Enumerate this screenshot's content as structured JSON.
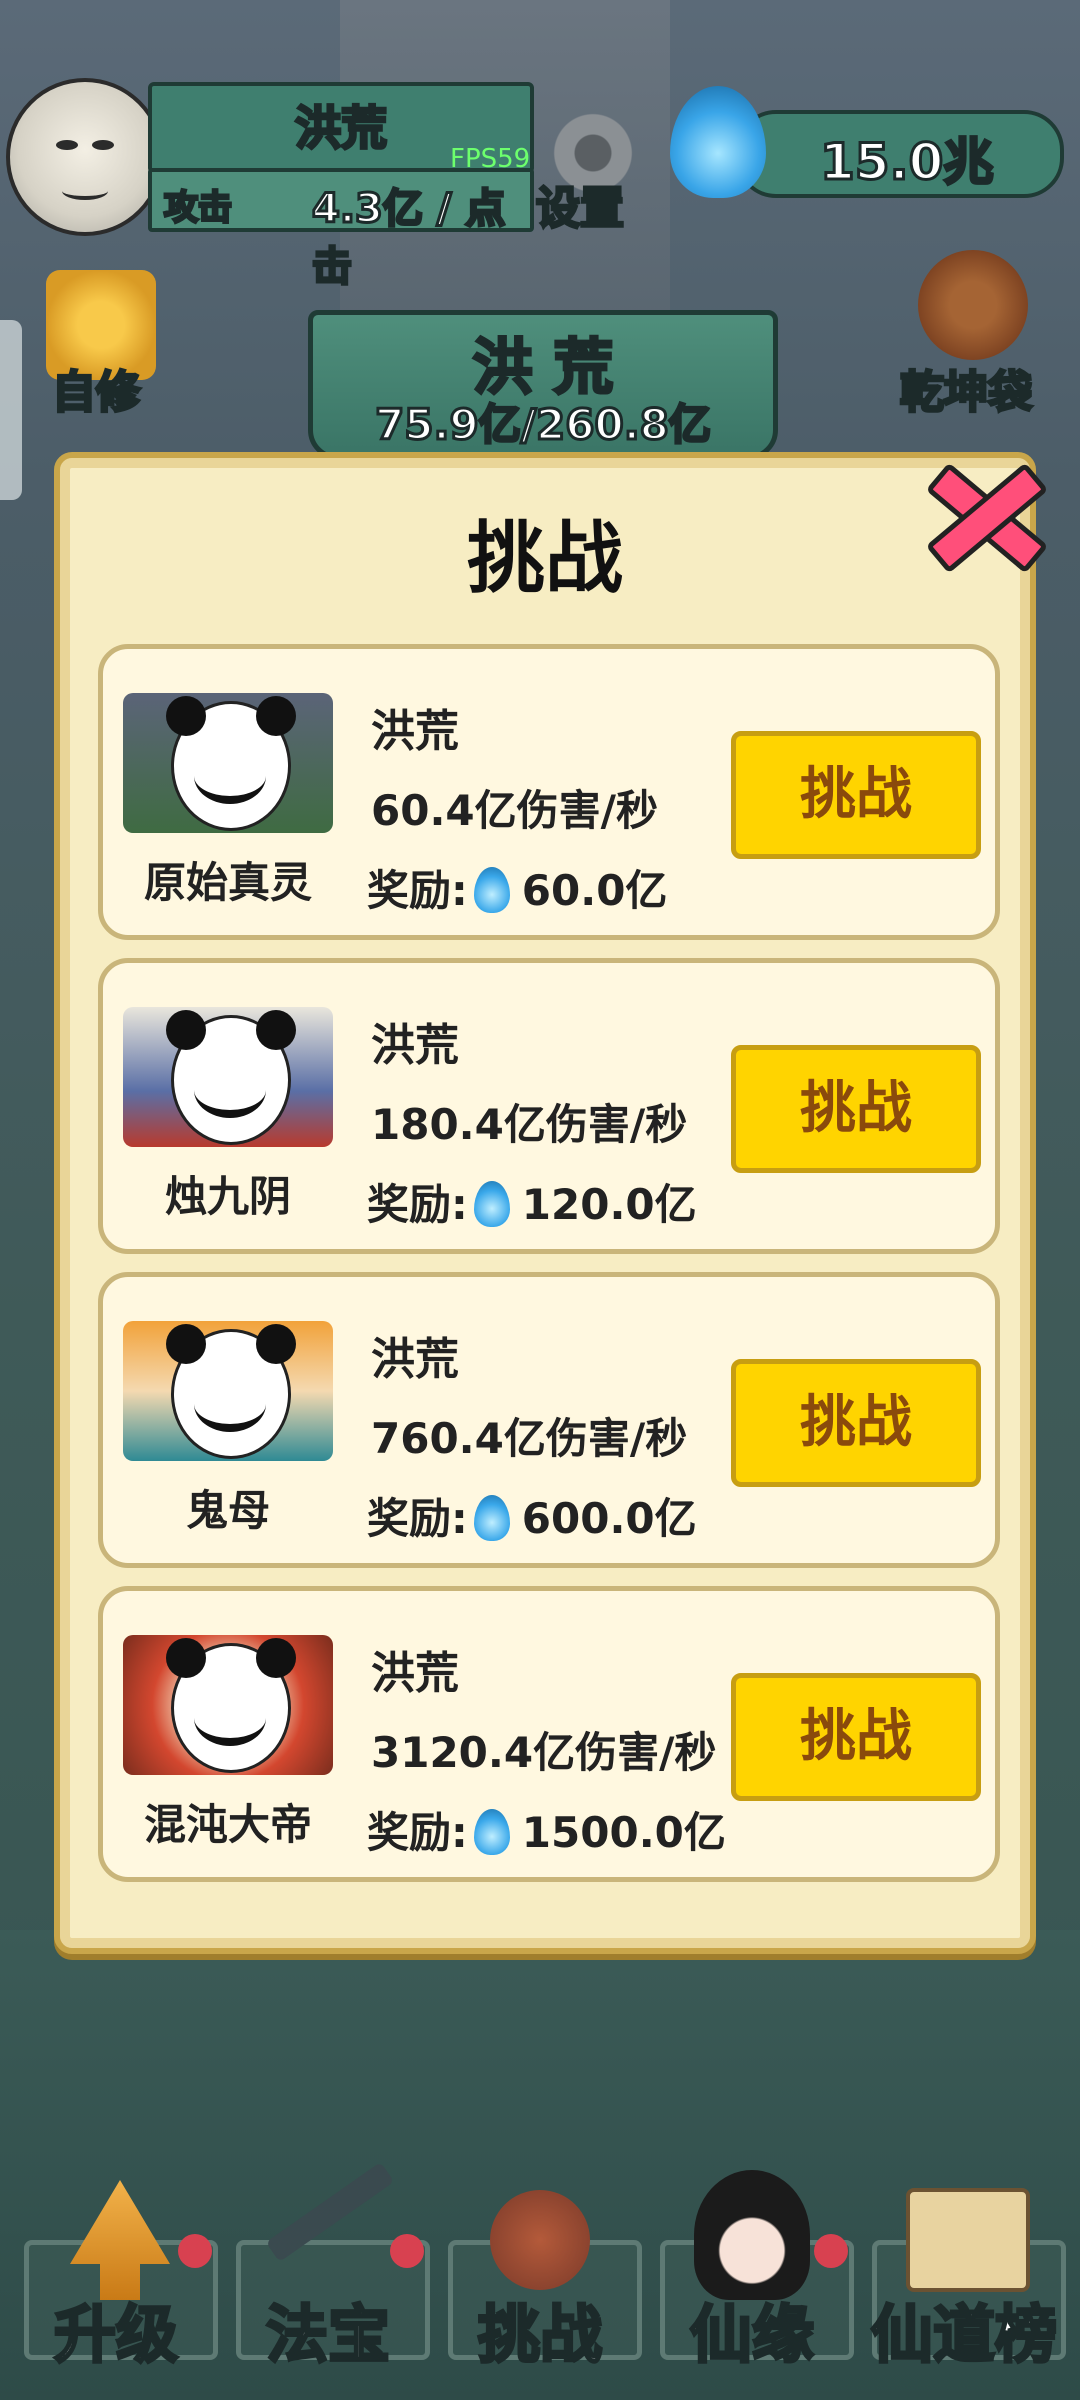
{
  "hud": {
    "player_name": "洪荒",
    "attack_label": "攻击",
    "attack_value": "4.3亿 / 点击",
    "fps": "FPS59",
    "settings_label": "设置",
    "currency": "15.0兆"
  },
  "side": {
    "left_label": "自修",
    "right_label": "乾坤袋"
  },
  "stage": {
    "title": "洪 荒",
    "progress": "75.9亿/260.8亿"
  },
  "modal": {
    "title": "挑战",
    "challenges": [
      {
        "boss": "原始真灵",
        "realm": "洪荒",
        "dps": "60.4亿伤害/秒",
        "reward_label": "奖励:",
        "reward": "60.0亿",
        "button": "挑战"
      },
      {
        "boss": "烛九阴",
        "realm": "洪荒",
        "dps": "180.4亿伤害/秒",
        "reward_label": "奖励:",
        "reward": "120.0亿",
        "button": "挑战"
      },
      {
        "boss": "鬼母",
        "realm": "洪荒",
        "dps": "760.4亿伤害/秒",
        "reward_label": "奖励:",
        "reward": "600.0亿",
        "button": "挑战"
      },
      {
        "boss": "混沌大帝",
        "realm": "洪荒",
        "dps": "3120.4亿伤害/秒",
        "reward_label": "奖励:",
        "reward": "1500.0亿",
        "button": "挑战"
      }
    ]
  },
  "nav": {
    "items": [
      {
        "label": "升级",
        "icon": "upgrade-icon",
        "has_dot": true
      },
      {
        "label": "法宝",
        "icon": "treasure-icon",
        "has_dot": true
      },
      {
        "label": "挑战",
        "icon": "crossed-swords-icon",
        "has_dot": false
      },
      {
        "label": "仙缘",
        "icon": "fairy-icon",
        "has_dot": true
      },
      {
        "label": "仙道榜",
        "icon": "ranking-scroll-icon",
        "has_dot": false
      }
    ]
  },
  "colors": {
    "button": "#ffd400",
    "button_text": "#8a4a0c",
    "modal_bg": "#f7edc3",
    "close": "#ff4f7a",
    "badge": "#d84150"
  }
}
